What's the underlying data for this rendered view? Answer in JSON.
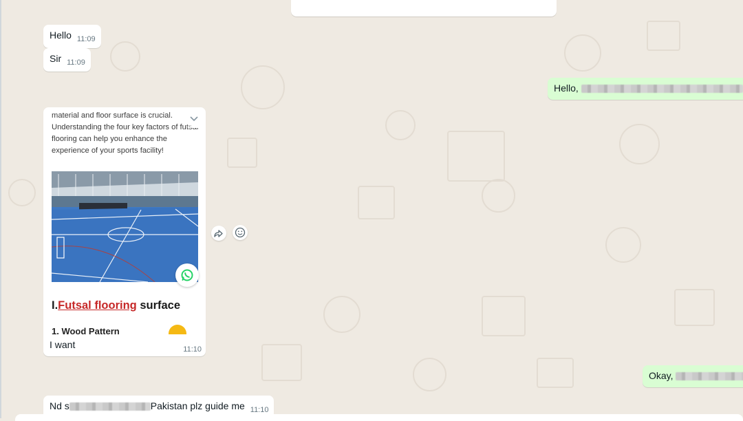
{
  "messages": {
    "hello": {
      "text": "Hello",
      "time": "11:09"
    },
    "sir": {
      "text": "Sir",
      "time": "11:09"
    },
    "out_hello": {
      "text": "Hello,"
    },
    "card": {
      "description": "material and floor surface is crucial. Understanding the four key factors of futsal flooring can help you enhance the experience of your sports facility!",
      "heading_prefix": "I.",
      "heading_link": "Futsal flooring",
      "heading_suffix": " surface",
      "subheading": "1. Wood Pattern",
      "caption": "I want",
      "time": "11:10"
    },
    "out_okay": {
      "text": "Okay,"
    },
    "last": {
      "prefix": "Nd s",
      "suffix": "Pakistan plz guide me",
      "time": "11:10"
    }
  },
  "icons": {
    "forward": "forward-icon",
    "emoji": "emoji-icon",
    "whatsapp": "whatsapp-icon",
    "chevron": "chevron-down-icon"
  },
  "colors": {
    "background": "#efeae2",
    "incoming": "#ffffff",
    "outgoing": "#d9fdd3",
    "link_red": "#c62828",
    "whatsapp_green": "#25d366"
  }
}
